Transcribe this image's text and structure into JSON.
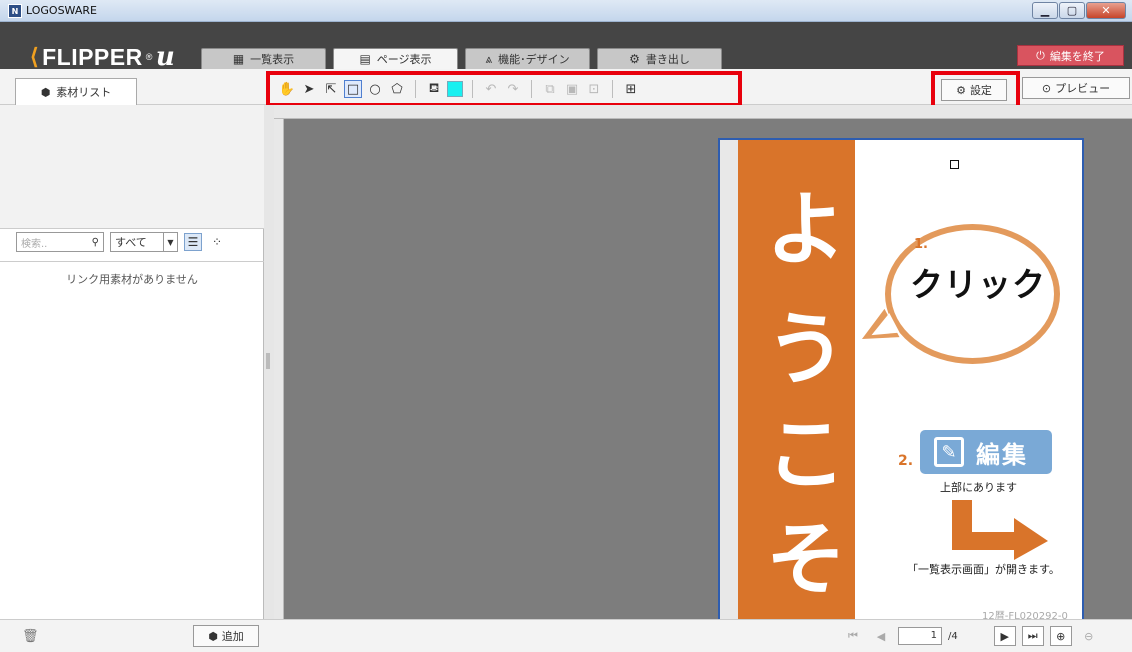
{
  "window": {
    "title": "LOGOSWARE",
    "app_icon_text": "N"
  },
  "header": {
    "logo_text": "FLIPPER",
    "logo_suffix": "u",
    "tabs": [
      {
        "label": "一覧表示",
        "icon": "grid-icon"
      },
      {
        "label": "ページ表示",
        "icon": "page-icon"
      },
      {
        "label": "機能･デザイン",
        "icon": "design-icon"
      },
      {
        "label": "書き出し",
        "icon": "gears-icon"
      }
    ],
    "end_button": "編集を終了"
  },
  "toolbar": {
    "side_tab": "素材リスト",
    "settings": "設定",
    "preview": "プレビュー",
    "swatch_color": "#19f0f0"
  },
  "left_panel": {
    "search_placeholder": "検索..",
    "filter_selected": "すべて",
    "empty_message": "リンク用素材がありません",
    "add_button": "追加"
  },
  "page_content": {
    "vertical_chars": [
      "よ",
      "う",
      "こ",
      "そ"
    ],
    "step1_num": "1.",
    "click_label": "クリック",
    "step2_num": "2.",
    "edit_label": "編集",
    "upper_text": "上部にあります",
    "opens_text": "「一覧表示画面」が開きます。",
    "code": "12暦-FL020292-0"
  },
  "pager": {
    "current": "1",
    "total": "/4"
  },
  "colors": {
    "accent": "#d9742a",
    "highlight": "#e8000c",
    "edit_blue": "#7aa9d6"
  }
}
